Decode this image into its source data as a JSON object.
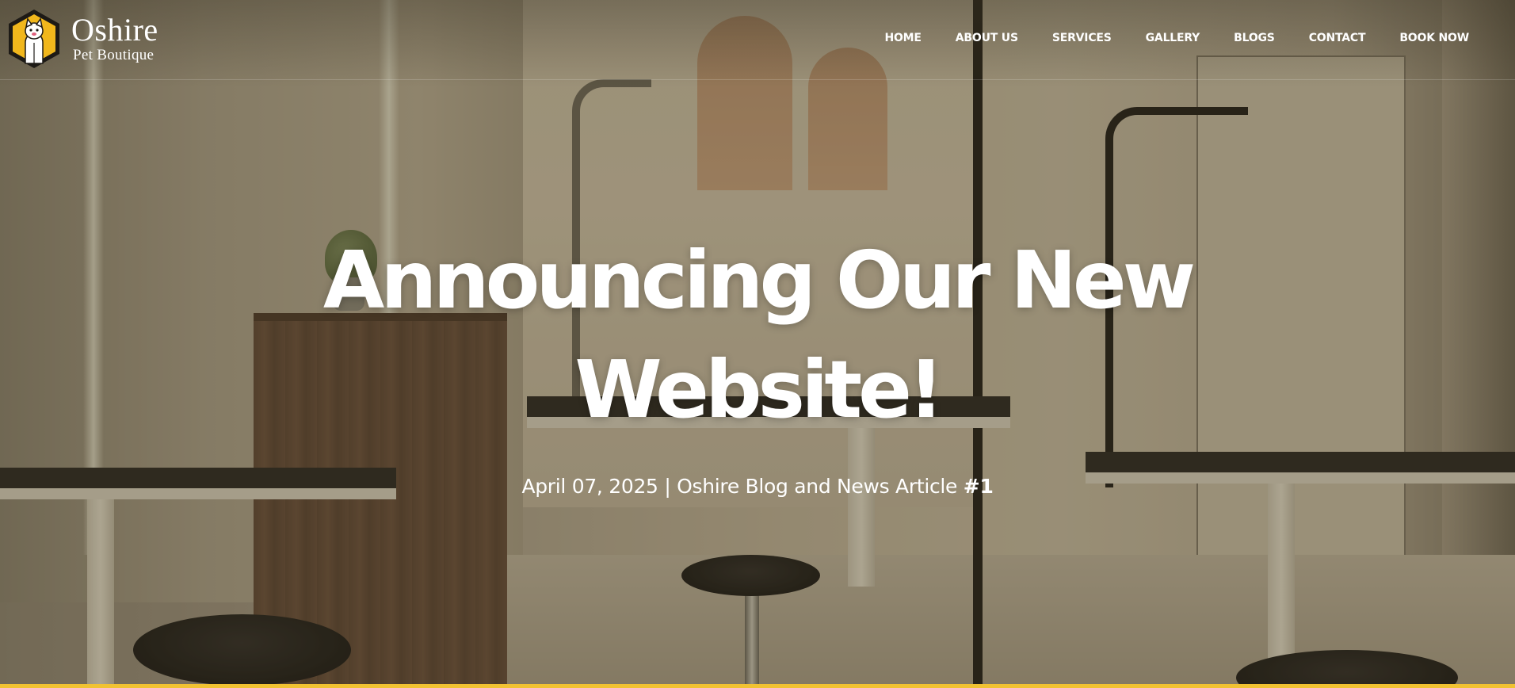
{
  "brand": {
    "name": "Oshire",
    "tagline": "Pet Boutique",
    "logo_icon": "cat-hexagon-logo-icon",
    "logo_colors": {
      "outer": "#1d1a16",
      "fill": "#f1b71c"
    }
  },
  "nav": {
    "items": [
      {
        "label": "HOME"
      },
      {
        "label": "ABOUT US"
      },
      {
        "label": "SERVICES"
      },
      {
        "label": "GALLERY"
      },
      {
        "label": "BLOGS"
      },
      {
        "label": "CONTACT"
      },
      {
        "label": "BOOK NOW"
      }
    ]
  },
  "hero": {
    "title_line1": "Announcing Our New",
    "title_line2": "Website!",
    "date": "April 07, 2025",
    "separator": "|",
    "article_label": "Oshire Blog and News Article",
    "article_number": "#1"
  },
  "colors": {
    "accent": "#f1c232",
    "text": "#ffffff"
  }
}
